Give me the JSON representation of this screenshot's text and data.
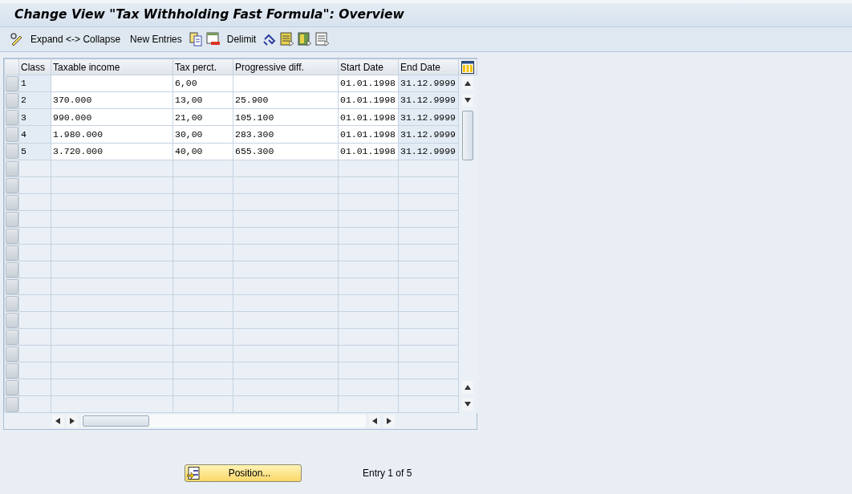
{
  "window": {
    "title": "Change View \"Tax Withholding Fast Formula\": Overview"
  },
  "toolbar": {
    "expand_collapse": "Expand <-> Collapse",
    "new_entries": "New Entries",
    "delimit": "Delimit"
  },
  "table": {
    "columns": [
      {
        "label": "Class",
        "key": true
      },
      {
        "label": "Taxable income",
        "key": false
      },
      {
        "label": "Tax perct.",
        "key": false
      },
      {
        "label": "Progressive diff.",
        "key": false
      },
      {
        "label": "Start Date",
        "key": false
      },
      {
        "label": "End Date",
        "key": true
      }
    ],
    "rows": [
      [
        "1",
        "",
        "6,00",
        "",
        "01.01.1998",
        "31.12.9999"
      ],
      [
        "2",
        "370.000",
        "13,00",
        "25.900",
        "01.01.1998",
        "31.12.9999"
      ],
      [
        "3",
        "990.000",
        "21,00",
        "105.100",
        "01.01.1998",
        "31.12.9999"
      ],
      [
        "4",
        "1.980.000",
        "30,00",
        "283.300",
        "01.01.1998",
        "31.12.9999"
      ],
      [
        "5",
        "3.720.000",
        "40,00",
        "655.300",
        "01.01.1998",
        "31.12.9999"
      ]
    ]
  },
  "footer": {
    "position_button": "Position...",
    "entry_info": "Entry 1 of 5"
  }
}
